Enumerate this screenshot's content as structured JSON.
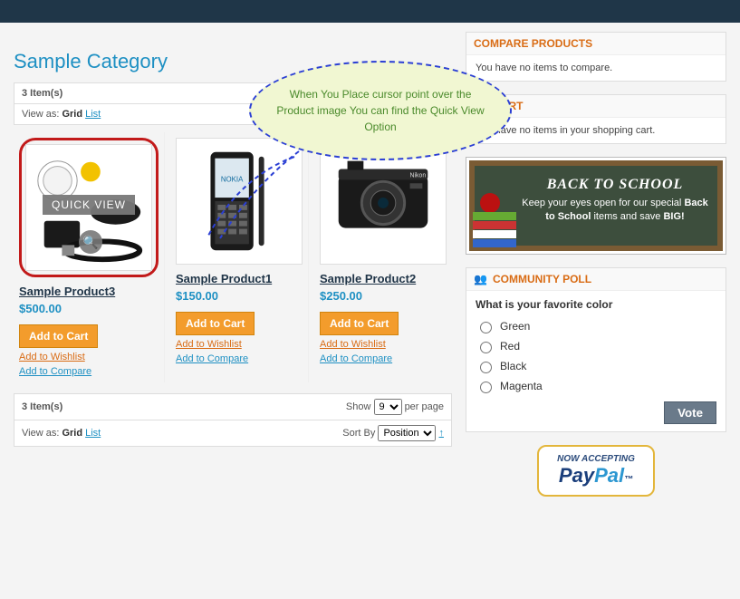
{
  "page": {
    "title": "Sample Category"
  },
  "toolbar": {
    "count": "3 Item(s)",
    "viewas_label": "View as:",
    "grid": "Grid",
    "list": "List",
    "show": "Show",
    "show_value": "9",
    "per_page": "per page",
    "sort_by": "Sort By",
    "sort_value": "Position",
    "sort_arrow": "↑"
  },
  "callout": {
    "text": "When You Place cursor point over the Product image You can find the Quick View Option"
  },
  "quickview_label": "QUICK VIEW",
  "buttons": {
    "add_to_cart": "Add to Cart",
    "add_to_wishlist": "Add to Wishlist",
    "add_to_compare": "Add to Compare",
    "vote": "Vote"
  },
  "products": [
    {
      "name": "Sample Product3",
      "price": "$500.00",
      "image": "accessories"
    },
    {
      "name": "Sample Product1",
      "price": "$150.00",
      "image": "phone"
    },
    {
      "name": "Sample Product2",
      "price": "$250.00",
      "image": "camera"
    }
  ],
  "sidebar": {
    "compare": {
      "title": "COMPARE PRODUCTS",
      "body": "You have no items to compare."
    },
    "cart": {
      "title": "MY CART",
      "body": "You have no items in your shopping cart."
    },
    "promo": {
      "heading": "BACK TO SCHOOL",
      "line1": "Keep your eyes open for our special ",
      "bold": "Back to School",
      "line2": " items and save ",
      "big": "BIG!"
    },
    "poll": {
      "title": "COMMUNITY POLL",
      "question": "What is your favorite color",
      "options": [
        "Green",
        "Red",
        "Black",
        "Magenta"
      ]
    },
    "paypal": {
      "line1": "NOW ACCEPTING",
      "brand_a": "Pay",
      "brand_b": "Pal"
    }
  }
}
